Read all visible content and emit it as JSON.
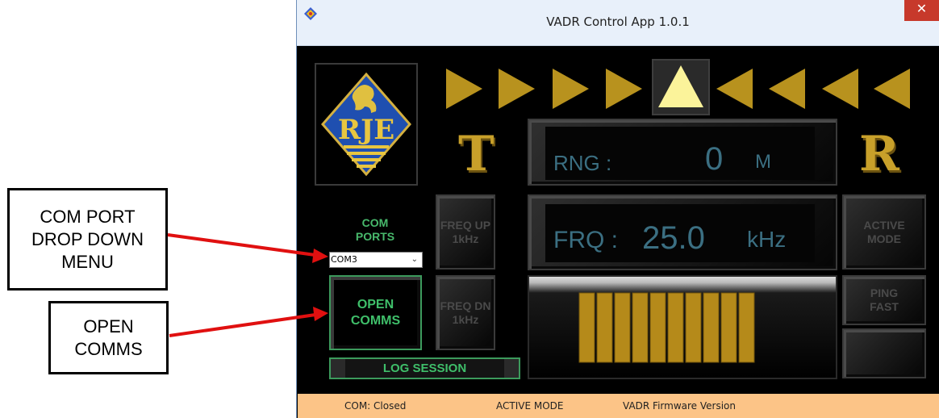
{
  "window": {
    "title": "VADR Control App 1.0.1",
    "close_glyph": "✕"
  },
  "annotations": {
    "com_port_callout": [
      "COM PORT",
      "DROP DOWN",
      "MENU"
    ],
    "open_comms_callout": [
      "OPEN",
      "COMMS"
    ]
  },
  "logo": {
    "text": "RJE"
  },
  "indicators": {
    "letter_t": "T",
    "letter_r": "R",
    "chevrons": [
      "right",
      "right",
      "right",
      "right",
      "up-active",
      "left",
      "left",
      "left",
      "left"
    ]
  },
  "range": {
    "label": "RNG :",
    "value": "0",
    "unit": "M"
  },
  "frequency": {
    "label": "FRQ :",
    "value": "25.0",
    "unit": "kHz"
  },
  "buttons": {
    "freq_up": [
      "FREQ UP",
      "1kHz"
    ],
    "freq_dn": [
      "FREQ DN",
      "1kHz"
    ],
    "active_mode": [
      "ACTIVE",
      "MODE"
    ],
    "ping_fast": [
      "PING",
      "FAST"
    ],
    "open_comms": [
      "OPEN",
      "COMMS"
    ],
    "log_session": "LOG SESSION"
  },
  "com_ports": {
    "label": [
      "COM",
      "PORTS"
    ],
    "selected": "COM3"
  },
  "signal_bars": {
    "count": 10,
    "color": "#b58a1a"
  },
  "status_bar": {
    "com_status": "COM: Closed",
    "mode": "ACTIVE MODE",
    "firmware": "VADR Firmware Version"
  },
  "colors": {
    "accent_gold": "#c8a02a",
    "accent_green": "#48b96c",
    "readout_blue": "#3b6f82",
    "status_bar_bg": "#fcc487",
    "arrow_red": "#e01010"
  }
}
